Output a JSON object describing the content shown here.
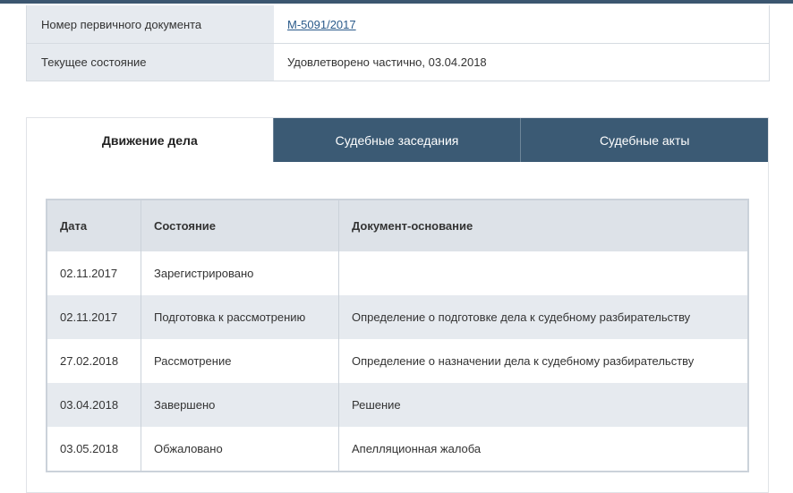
{
  "case_info": {
    "rows": [
      {
        "label": "Номер первичного документа",
        "value": "М-5091/2017",
        "is_link": true
      },
      {
        "label": "Текущее состояние",
        "value": "Удовлетворено частично, 03.04.2018",
        "is_link": false
      }
    ]
  },
  "tabs": [
    {
      "label": "Движение дела",
      "active": true
    },
    {
      "label": "Судебные заседания",
      "active": false
    },
    {
      "label": "Судебные акты",
      "active": false
    }
  ],
  "events_table": {
    "headers": [
      "Дата",
      "Состояние",
      "Документ-основание"
    ],
    "rows": [
      {
        "date": "02.11.2017",
        "state": "Зарегистрировано",
        "document": ""
      },
      {
        "date": "02.11.2017",
        "state": "Подготовка к рассмотрению",
        "document": "Определение о подготовке дела к судебному разбирательству"
      },
      {
        "date": "27.02.2018",
        "state": "Рассмотрение",
        "document": "Определение о назначении дела к судебному разбирательству"
      },
      {
        "date": "03.04.2018",
        "state": "Завершено",
        "document": "Решение"
      },
      {
        "date": "03.05.2018",
        "state": "Обжаловано",
        "document": "Апелляционная жалоба"
      }
    ]
  },
  "colors": {
    "accent": "#3b5a74",
    "label_bg": "#e6eaef",
    "link": "#2a5a8a"
  }
}
